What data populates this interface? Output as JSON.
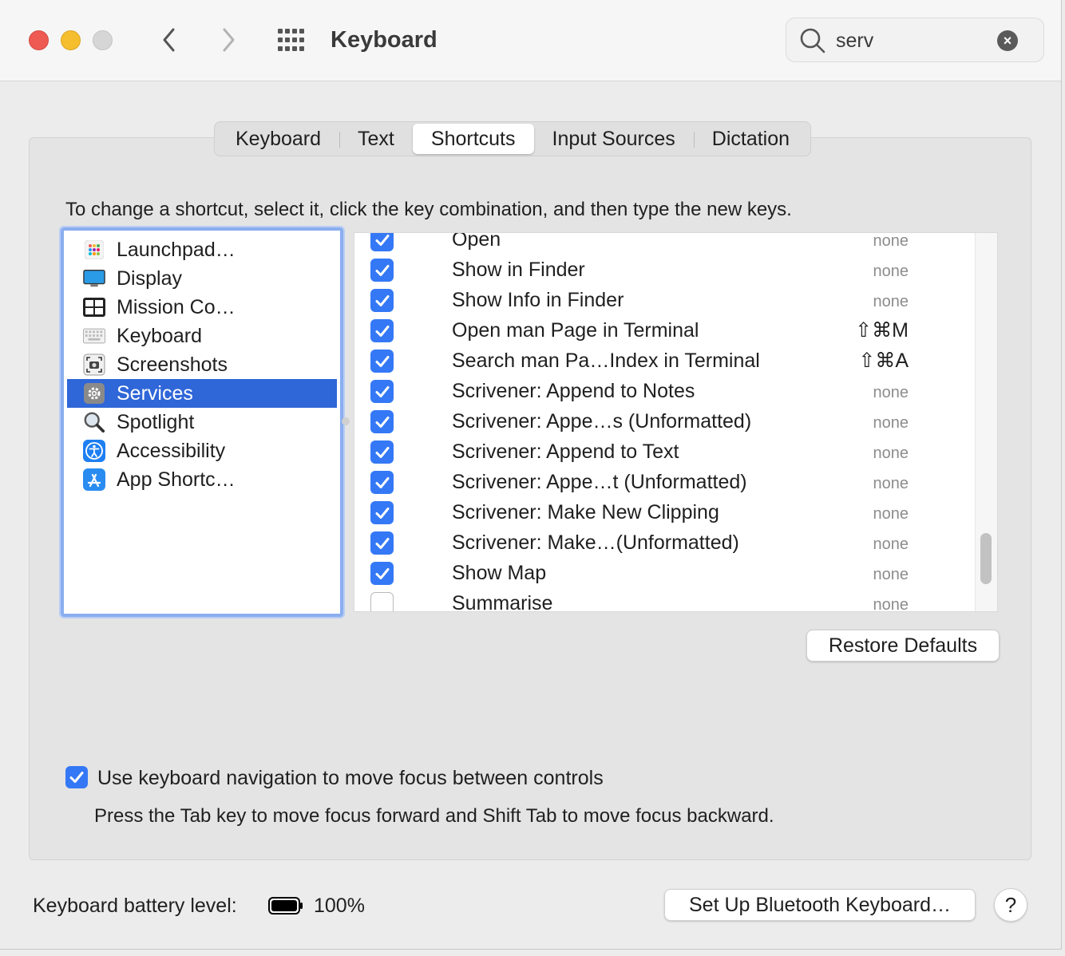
{
  "window": {
    "title": "Keyboard",
    "search": {
      "value": "serv",
      "placeholder": "Search"
    }
  },
  "tabs": [
    {
      "label": "Keyboard"
    },
    {
      "label": "Text"
    },
    {
      "label": "Shortcuts",
      "active": true
    },
    {
      "label": "Input Sources"
    },
    {
      "label": "Dictation"
    }
  ],
  "instructions": "To change a shortcut, select it, click the key combination, and then type the new keys.",
  "categories": [
    {
      "label": "Launchpad…",
      "icon": "launchpad-icon"
    },
    {
      "label": "Display",
      "icon": "display-icon"
    },
    {
      "label": "Mission Co…",
      "icon": "mission-control-icon"
    },
    {
      "label": "Keyboard",
      "icon": "keyboard-icon"
    },
    {
      "label": "Screenshots",
      "icon": "screenshot-icon"
    },
    {
      "label": "Services",
      "icon": "gear-icon",
      "selected": true
    },
    {
      "label": "Spotlight",
      "icon": "magnifier-icon"
    },
    {
      "label": "Accessibility",
      "icon": "accessibility-icon"
    },
    {
      "label": "App Shortc…",
      "icon": "app-store-icon"
    }
  ],
  "services": [
    {
      "name": "Open",
      "shortcut": "none",
      "checked": true
    },
    {
      "name": "Show in Finder",
      "shortcut": "none",
      "checked": true
    },
    {
      "name": "Show Info in Finder",
      "shortcut": "none",
      "checked": true
    },
    {
      "name": "Open man Page in Terminal",
      "shortcut": "⇧⌘M",
      "checked": true
    },
    {
      "name": "Search man Pa…Index in Terminal",
      "shortcut": "⇧⌘A",
      "checked": true
    },
    {
      "name": "Scrivener: Append to Notes",
      "shortcut": "none",
      "checked": true
    },
    {
      "name": "Scrivener: Appe…s (Unformatted)",
      "shortcut": "none",
      "checked": true
    },
    {
      "name": "Scrivener: Append to Text",
      "shortcut": "none",
      "checked": true
    },
    {
      "name": "Scrivener: Appe…t (Unformatted)",
      "shortcut": "none",
      "checked": true
    },
    {
      "name": "Scrivener: Make New Clipping",
      "shortcut": "none",
      "checked": true
    },
    {
      "name": "Scrivener: Make…(Unformatted)",
      "shortcut": "none",
      "checked": true
    },
    {
      "name": "Show Map",
      "shortcut": "none",
      "checked": true
    },
    {
      "name": "Summarise",
      "shortcut": "none",
      "checked": false
    }
  ],
  "restore_defaults": "Restore Defaults",
  "keyboard_navigation": {
    "label": "Use keyboard navigation to move focus between controls",
    "hint": "Press the Tab key to move focus forward and Shift Tab to move focus backward.",
    "checked": true
  },
  "battery": {
    "label": "Keyboard battery level:",
    "value": "100%",
    "level": 1.0
  },
  "bluetooth_button": "Set Up Bluetooth Keyboard…",
  "help_button": "?",
  "colors": {
    "accent": "#3478f6",
    "selection": "#2f66d8",
    "focus_ring": "#8aaef0"
  }
}
